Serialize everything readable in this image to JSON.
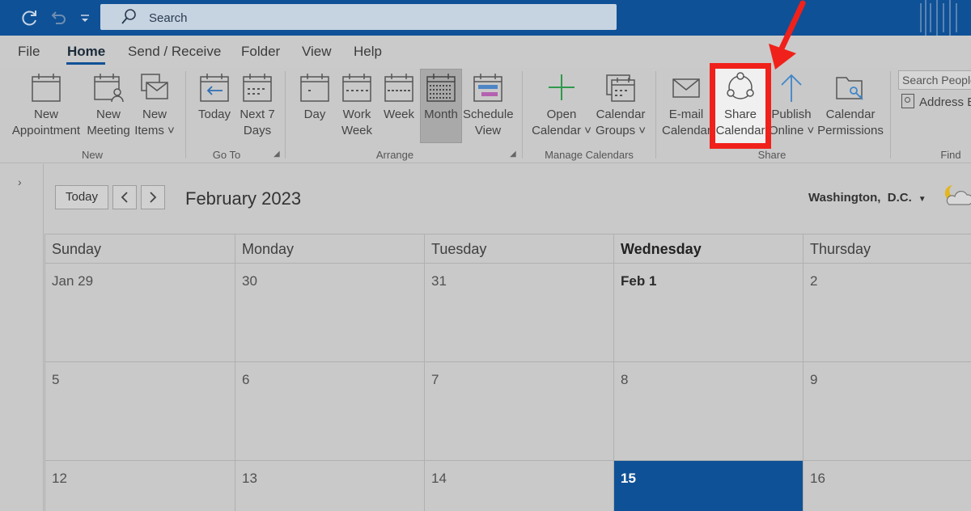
{
  "titlebar": {
    "search_placeholder": "Search",
    "colors": {
      "bar": "#0f5196",
      "search_bg": "#c6d3e1"
    }
  },
  "menu": {
    "file": "File",
    "home": "Home",
    "send_receive": "Send / Receive",
    "folder": "Folder",
    "view": "View",
    "help": "Help"
  },
  "ribbon": {
    "new_group": {
      "label": "New",
      "new_appointment": [
        "New",
        "Appointment"
      ],
      "new_meeting": [
        "New",
        "Meeting"
      ],
      "new_items": [
        "New",
        "Items ˅"
      ]
    },
    "goto_group": {
      "label": "Go To",
      "today": [
        "Today",
        ""
      ],
      "next7": [
        "Next 7",
        "Days"
      ]
    },
    "arrange_group": {
      "label": "Arrange",
      "day": [
        "Day",
        ""
      ],
      "work_week": [
        "Work",
        "Week"
      ],
      "week": [
        "Week",
        ""
      ],
      "month": [
        "Month",
        ""
      ],
      "schedule_view": [
        "Schedule",
        "View"
      ]
    },
    "manage_group": {
      "label": "Manage Calendars",
      "open_calendar": [
        "Open",
        "Calendar ˅"
      ],
      "calendar_groups": [
        "Calendar",
        "Groups ˅"
      ]
    },
    "share_group": {
      "label": "Share",
      "email_calendar": [
        "E-mail",
        "Calendar"
      ],
      "share_calendar": [
        "Share",
        "Calendar"
      ],
      "publish_online": [
        "Publish",
        "Online ˅"
      ],
      "calendar_permissions": [
        "Calendar",
        "Permissions"
      ]
    },
    "find_group": {
      "label": "Find",
      "search_people": "Search People",
      "address_book": "Address Book"
    },
    "highlight_color": "#f0211a"
  },
  "calendar": {
    "today_btn": "Today",
    "prev_icon": "chevron-left-icon",
    "next_icon": "chevron-right-icon",
    "month_title": "February 2023",
    "location": "Washington,  D.C.",
    "weekdays": [
      "Sunday",
      "Monday",
      "Tuesday",
      "Wednesday",
      "Thursday"
    ],
    "today_weekday_index": 3,
    "weeks": [
      [
        "Jan 29",
        "30",
        "31",
        "Feb 1",
        "2"
      ],
      [
        "5",
        "6",
        "7",
        "8",
        "9"
      ],
      [
        "12",
        "13",
        "14",
        "15",
        "16"
      ]
    ],
    "selected_color": "#0f5196"
  }
}
